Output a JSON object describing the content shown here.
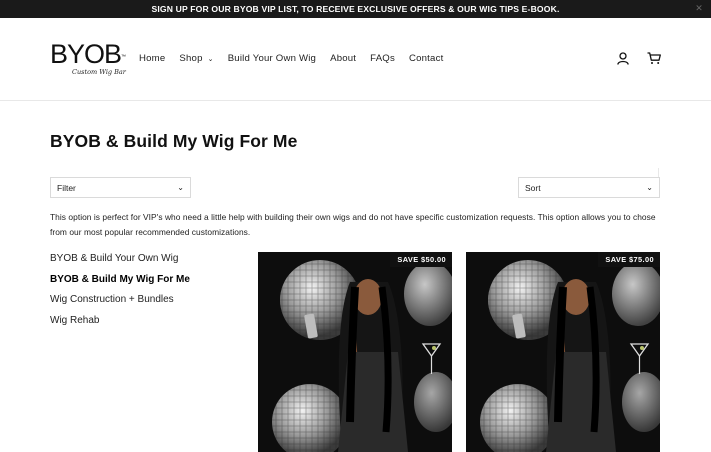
{
  "announcement": {
    "text": "SIGN UP FOR OUR BYOB VIP LIST, TO RECEIVE EXCLUSIVE OFFERS & OUR WIG TIPS E-BOOK.",
    "close_icon": "close-icon"
  },
  "brand": {
    "logo_text": "BYOB",
    "logo_tm": "™",
    "logo_script": "Custom Wig Bar"
  },
  "nav": {
    "home": "Home",
    "shop": "Shop",
    "build": "Build Your Own Wig",
    "about": "About",
    "faqs": "FAQs",
    "contact": "Contact"
  },
  "header_icons": [
    "account-icon",
    "cart-icon"
  ],
  "page": {
    "title": "BYOB & Build My Wig For Me",
    "filter_label": "Filter",
    "sort_label": "Sort",
    "description": "This option is perfect for VIP's who need a little help with building their own wigs and do not have specific customization requests. This option allows you to chose from our most popular recommended customizations."
  },
  "collections": [
    {
      "label": "BYOB & Build Your Own Wig",
      "active": false
    },
    {
      "label": "BYOB & Build My Wig For Me",
      "active": true
    },
    {
      "label": "Wig Construction + Bundles",
      "active": false
    },
    {
      "label": "Wig Rehab",
      "active": false
    }
  ],
  "products": [
    {
      "badge": "SAVE $50.00"
    },
    {
      "badge": "SAVE $75.00"
    }
  ],
  "colors": {
    "announcement_bg": "#1a1a1a",
    "text": "#111111",
    "border": "#dadada"
  }
}
